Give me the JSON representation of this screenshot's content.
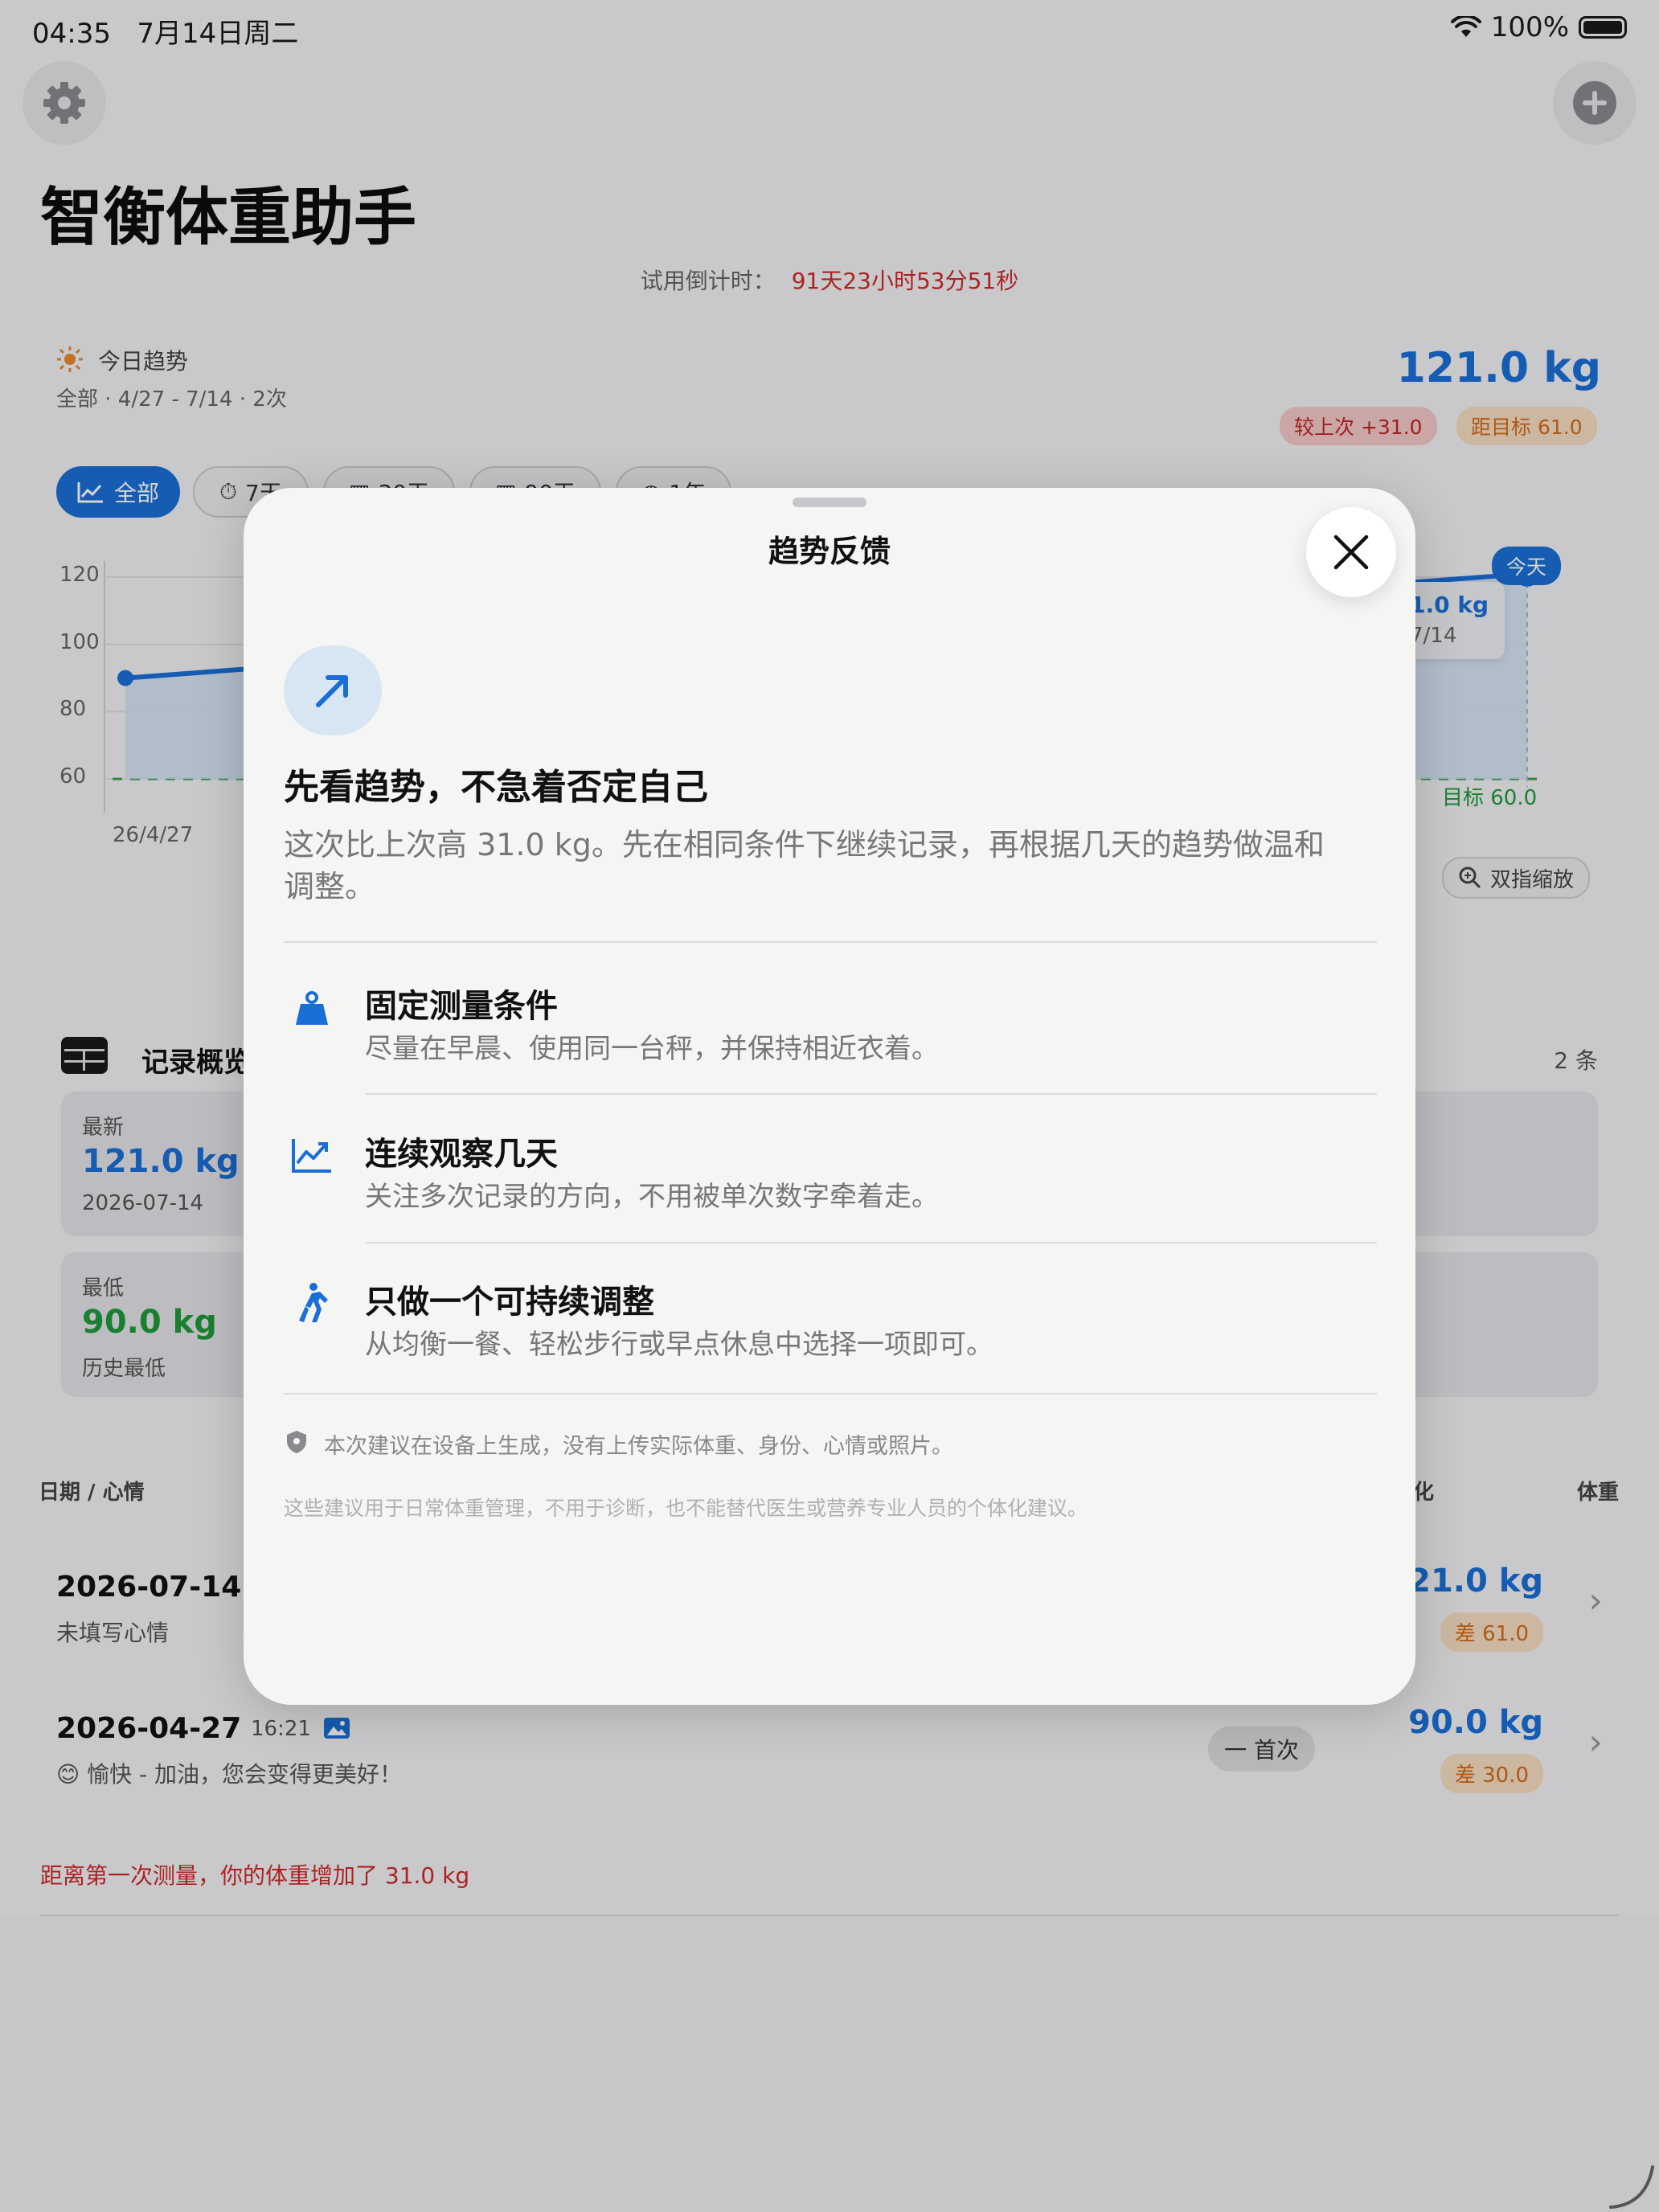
{
  "status_bar": {
    "time": "04:35",
    "date": "7月14日周二",
    "battery": "100%"
  },
  "header": {
    "title": "智衡体重助手",
    "trial_label": "试用倒计时：",
    "trial_countdown": "91天23小时53分51秒"
  },
  "trend": {
    "label": "今日趋势",
    "subtitle": "全部 · 4/27 - 7/14 · 2次",
    "current_weight": "121.0 kg",
    "vs_last": "较上次 +31.0",
    "to_goal": "距目标 61.0"
  },
  "filters": [
    "全部",
    "7天",
    "30天",
    "90天",
    "1年"
  ],
  "chart_data": {
    "type": "line",
    "x": [
      "2026-04-27",
      "2026-07-14"
    ],
    "values": [
      90.0,
      121.0
    ],
    "yticks": [
      120,
      100,
      80,
      60
    ],
    "first_x_label": "26/4/27",
    "goal": 60.0,
    "goal_label": "目标 60.0",
    "today_label": "今天",
    "tooltip_value": "1.0 kg",
    "tooltip_date": "7/14",
    "zoom_hint": "双指缩放"
  },
  "records": {
    "title": "记录概览",
    "count": "2 条",
    "latest_label": "最新",
    "latest_value": "121.0 kg",
    "latest_date": "2026-07-14",
    "lowest_label": "最低",
    "lowest_value": "90.0 kg",
    "lowest_note": "历史最低"
  },
  "table": {
    "col_date": "日期 / 心情",
    "col_change": "化",
    "col_weight": "体重",
    "rows": [
      {
        "date": "2026-07-14",
        "time": "",
        "mood": "未填写心情",
        "weight": "121.0 kg",
        "diff": "差 61.0",
        "badge": ""
      },
      {
        "date": "2026-04-27",
        "time": "16:21",
        "mood": "😊 愉快 - 加油，您会变得更美好！",
        "weight": "90.0 kg",
        "diff": "差 30.0",
        "badge": "一 首次"
      }
    ],
    "footer": "距离第一次测量，你的体重增加了 31.0 kg"
  },
  "modal": {
    "title": "趋势反馈",
    "headline": "先看趋势，不急着否定自己",
    "description": "这次比上次高 31.0 kg。先在相同条件下继续记录，再根据几天的趋势做温和调整。",
    "tips": [
      {
        "icon": "scale-weight-icon",
        "title": "固定测量条件",
        "desc": "尽量在早晨、使用同一台秤，并保持相近衣着。"
      },
      {
        "icon": "trend-chart-icon",
        "title": "连续观察几天",
        "desc": "关注多次记录的方向，不用被单次数字牵着走。"
      },
      {
        "icon": "walking-icon",
        "title": "只做一个可持续调整",
        "desc": "从均衡一餐、轻松步行或早点休息中选择一项即可。"
      }
    ],
    "privacy": "本次建议在设备上生成，没有上传实际体重、身份、心情或照片。",
    "disclaimer": "这些建议用于日常体重管理，不用于诊断，也不能替代医生或营养专业人员的个体化建议。"
  },
  "colors": {
    "accent": "#1a6fd6",
    "danger": "#d02a2a",
    "warning": "#d46a1a",
    "success": "#1f9a3a"
  }
}
